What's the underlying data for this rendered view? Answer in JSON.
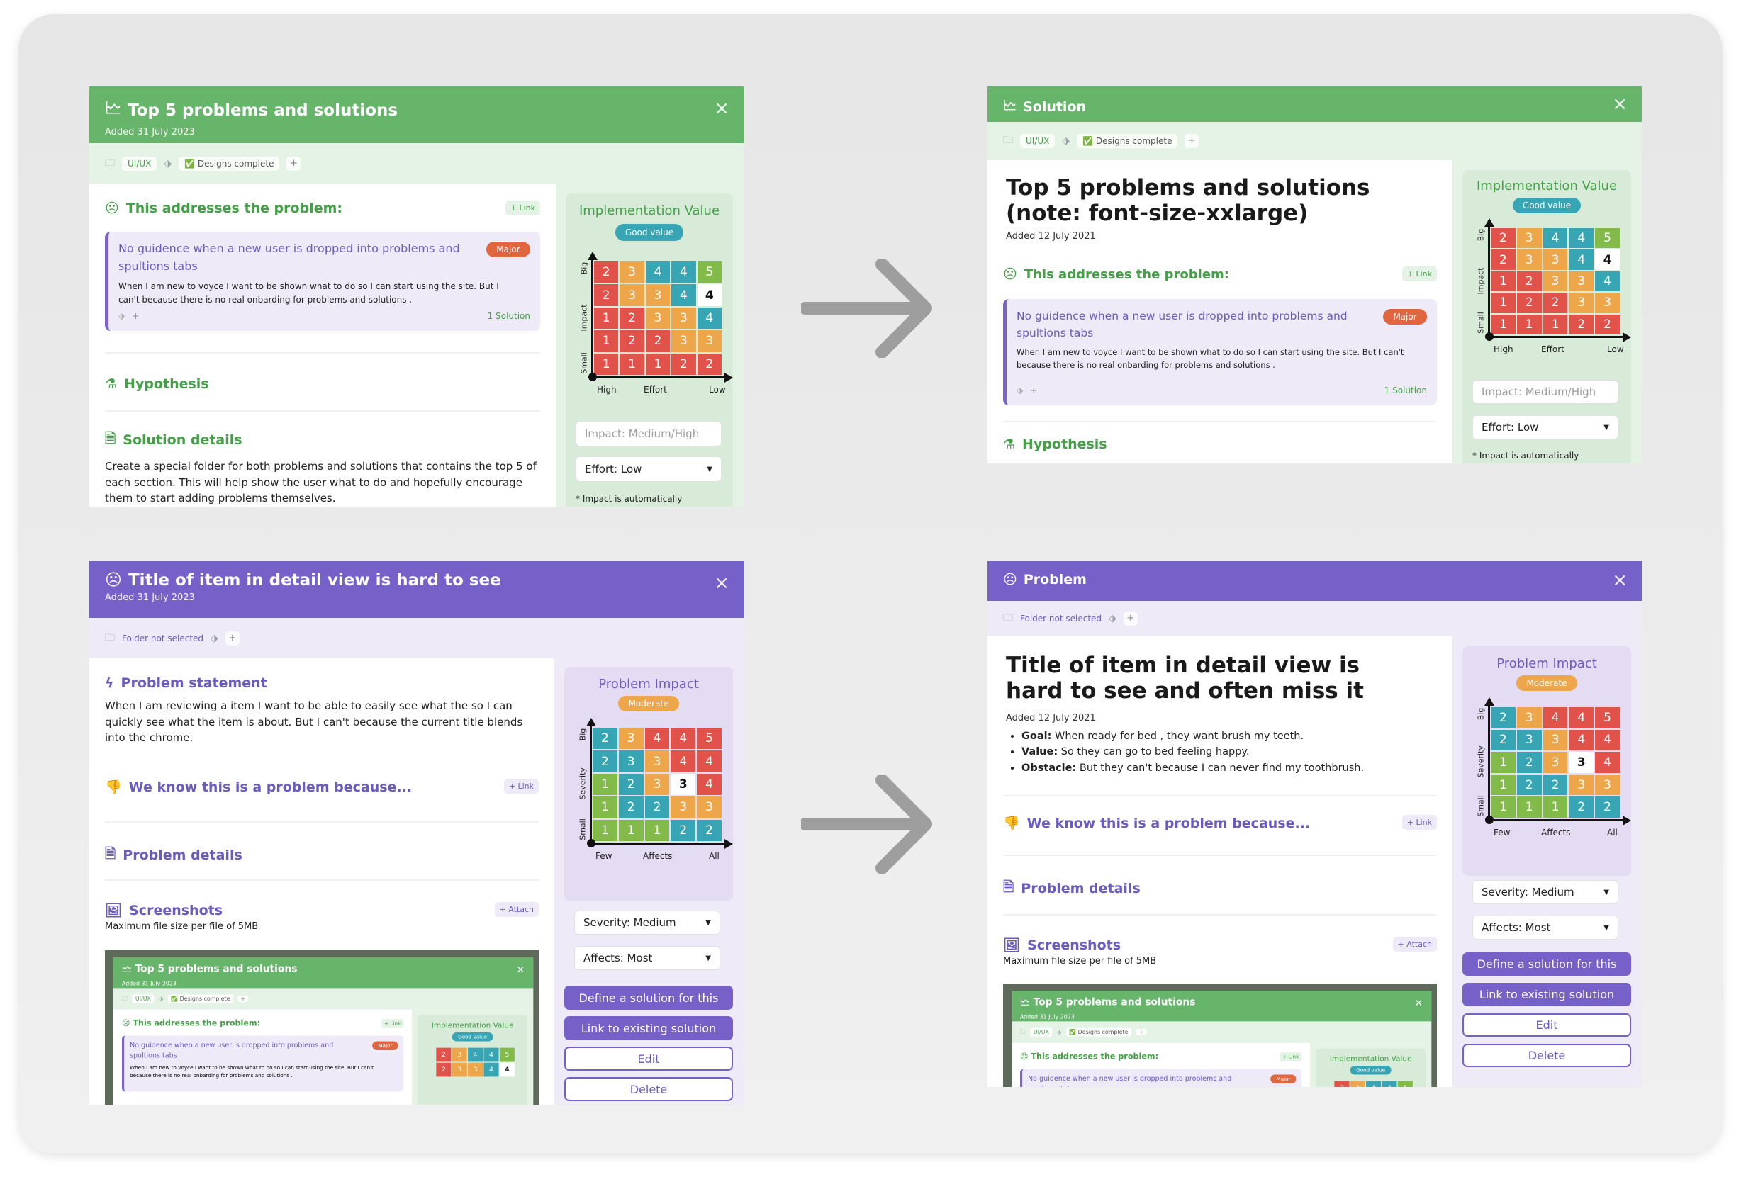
{
  "colors": {
    "green": "#67b56b",
    "green_light": "#e5f3e6",
    "purple": "#7561c7",
    "purple_light": "#efeaf8",
    "grey_arrow": "#9e9e9e"
  },
  "matrix": {
    "impl_colors": [
      [
        "red",
        "orange",
        "teal",
        "teal",
        "green"
      ],
      [
        "red",
        "orange",
        "orange",
        "teal",
        "white"
      ],
      [
        "red",
        "red",
        "orange",
        "orange",
        "teal"
      ],
      [
        "red",
        "red",
        "red",
        "orange",
        "orange"
      ],
      [
        "red",
        "red",
        "red",
        "red",
        "red"
      ]
    ],
    "impl_values": [
      [
        "2",
        "3",
        "4",
        "4",
        "5"
      ],
      [
        "2",
        "3",
        "3",
        "4",
        "4"
      ],
      [
        "1",
        "2",
        "3",
        "3",
        "4"
      ],
      [
        "1",
        "2",
        "2",
        "3",
        "3"
      ],
      [
        "1",
        "1",
        "1",
        "2",
        "2"
      ]
    ],
    "impl_selected": [
      1,
      4
    ],
    "prob_colors": [
      [
        "teal",
        "orange",
        "red",
        "red",
        "red"
      ],
      [
        "teal",
        "teal",
        "orange",
        "red",
        "red"
      ],
      [
        "green",
        "teal",
        "orange",
        "white",
        "red"
      ],
      [
        "green",
        "teal",
        "teal",
        "orange",
        "orange"
      ],
      [
        "green",
        "green",
        "green",
        "teal",
        "teal"
      ]
    ],
    "prob_values": [
      [
        "2",
        "3",
        "4",
        "4",
        "5"
      ],
      [
        "2",
        "3",
        "3",
        "4",
        "4"
      ],
      [
        "1",
        "2",
        "3",
        "3",
        "4"
      ],
      [
        "1",
        "2",
        "2",
        "3",
        "3"
      ],
      [
        "1",
        "1",
        "1",
        "2",
        "2"
      ]
    ],
    "prob_selected": [
      2,
      3
    ],
    "palette": {
      "red": "#e0524a",
      "orange": "#eda64a",
      "teal": "#37a5b3",
      "green": "#83bb4a",
      "white": "#ffffff"
    }
  },
  "p1": {
    "title": "Top 5 problems and solutions",
    "added": "Added 31 July 2023",
    "folder": "UI/UX",
    "tag": "✅ Designs complete",
    "addresses": "This addresses the problem:",
    "link": "+ Link",
    "card_title": "No guidence when a new user is dropped into problems and spultions tabs",
    "card_badge": "Major",
    "card_body": "When I am new to voyce I want to be shown what to do so I can start using the site. But I can't because there is no real onbarding for problems and solutions .",
    "card_sol": "1 Solution",
    "hypothesis": "Hypothesis",
    "sol_details": "Solution details",
    "sol_text": "Create a special folder for both problems and solutions that contains the top 5 of each section. This will help show the user what to do and hopefully encourage them to start adding problems themselves.",
    "impl_title": "Implementation Value",
    "impl_badge": "Good value",
    "y_big": "Big",
    "y_mid": "Impact",
    "y_small": "Small",
    "x_left": "High",
    "x_mid": "Effort",
    "x_right": "Low",
    "impact_ph": "Impact: Medium/High",
    "effort": "Effort: Low",
    "note": "* Impact is automatically"
  },
  "p2": {
    "title": "Solution",
    "folder": "UI/UX",
    "tag": "✅ Designs complete",
    "big": "Top 5 problems and solutions (note: font-size-xxlarge)",
    "added": "Added 12 July 2021",
    "addresses": "This addresses the problem:",
    "link": "+ Link",
    "card_title": "No guidence when a new user is dropped into problems and spultions tabs",
    "card_badge": "Major",
    "card_body": "When I am new to voyce I want to be shown what to do so I can start using the site. But I can't because there is no real onbarding for problems and solutions .",
    "card_sol": "1 Solution",
    "hypothesis": "Hypothesis",
    "impl_title": "Implementation Value",
    "impl_badge": "Good value",
    "y_big": "Big",
    "y_mid": "Impact",
    "y_small": "Small",
    "x_left": "High",
    "x_mid": "Effort",
    "x_right": "Low",
    "impact_ph": "Impact: Medium/High",
    "effort": "Effort: Low",
    "note": "* Impact is automatically"
  },
  "p3": {
    "title": "Title of item in detail view is hard to see",
    "added": "Added 31 July 2023",
    "folder": "Folder not selected",
    "statement": "Problem statement",
    "statement_text": "When I am reviewing a item I want to be able to easily see what the so I can quickly see what the item is about. But I can't because the current title blends into the chrome.",
    "know": "We know this is a problem because...",
    "link": "+ Link",
    "details": "Problem details",
    "screenshots": "Screenshots",
    "attach": "+ Attach",
    "max": "Maximum file size per file of 5MB",
    "impact_title": "Problem Impact",
    "impact_badge": "Moderate",
    "y_big": "Big",
    "y_mid": "Severity",
    "y_small": "Small",
    "x_left": "Few",
    "x_mid": "Affects",
    "x_right": "All",
    "severity": "Severity: Medium",
    "affects": "Affects: Most",
    "btn_define": "Define a solution for this",
    "btn_link": "Link to existing solution",
    "btn_edit": "Edit",
    "btn_delete": "Delete"
  },
  "p4": {
    "title": "Problem",
    "folder": "Folder not selected",
    "big": "Title of item in detail view is hard to see and often miss it",
    "added": "Added 12 July 2021",
    "goal_k": "Goal:",
    "goal_v": " When ready for bed , they want brush my teeth.",
    "value_k": "Value:",
    "value_v": " So they can go to bed feeling happy.",
    "obst_k": "Obstacle:",
    "obst_v": " But they can't because I can never find my toothbrush.",
    "know": "We know this is a problem because...",
    "link": "+ Link",
    "details": "Problem details",
    "screenshots": "Screenshots",
    "attach": "+ Attach",
    "max": "Maximum file size per file of 5MB",
    "impact_title": "Problem Impact",
    "impact_badge": "Moderate",
    "y_big": "Big",
    "y_mid": "Severity",
    "y_small": "Small",
    "x_left": "Few",
    "x_mid": "Affects",
    "x_right": "All",
    "severity": "Severity: Medium",
    "affects": "Affects: Most",
    "btn_define": "Define a solution for this",
    "btn_link": "Link to existing solution",
    "btn_edit": "Edit",
    "btn_delete": "Delete"
  },
  "thumb": {
    "title": "Top 5 problems and solutions",
    "added": "Added 31 July 2023",
    "folder": "UI/UX",
    "tag": "✅ Designs complete",
    "addresses": "This addresses the problem:",
    "link": "+ Link",
    "card_title": "No guidence when a new user is dropped into problems and spultions tabs",
    "card_badge": "Major",
    "card_body": "When I am new to voyce I want to be shown what to do so I can start using the site. But I can't because there is no real onbarding for problems and solutions .",
    "impl_title": "Implementation Value",
    "impl_badge": "Good value",
    "impl_row1": [
      "2",
      "3",
      "4",
      "4",
      "5"
    ],
    "impl_row2": [
      "2",
      "3",
      "3",
      "4",
      "4"
    ]
  }
}
